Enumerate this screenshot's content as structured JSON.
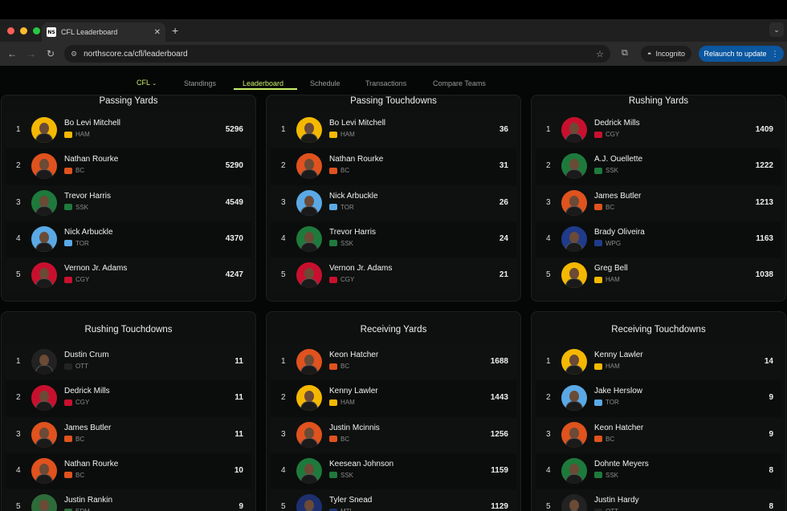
{
  "browser": {
    "tab_title": "CFL Leaderboard",
    "tab_favicon_text": "NS",
    "url": "northscore.ca/cfl/leaderboard",
    "incognito_label": "Incognito",
    "relaunch_label": "Relaunch to update"
  },
  "nav": {
    "league": "CFL",
    "items": [
      "Standings",
      "Leaderboard",
      "Schedule",
      "Transactions",
      "Compare Teams"
    ],
    "active": "Leaderboard"
  },
  "team_colors": {
    "HAM": "#f5b800",
    "BC": "#e0521e",
    "SSK": "#1e7a3c",
    "TOR": "#5aa9e6",
    "CGY": "#c8102e",
    "WPG": "#1f3b8a",
    "OTT": "#222222",
    "EDM": "#2e6b3a",
    "MTL": "#1d2f6f"
  },
  "cards": [
    {
      "title": "Passing Yards",
      "rows": [
        {
          "rank": "1",
          "name": "Bo Levi Mitchell",
          "team": "HAM",
          "value": "5296"
        },
        {
          "rank": "2",
          "name": "Nathan Rourke",
          "team": "BC",
          "value": "5290"
        },
        {
          "rank": "3",
          "name": "Trevor Harris",
          "team": "SSK",
          "value": "4549"
        },
        {
          "rank": "4",
          "name": "Nick Arbuckle",
          "team": "TOR",
          "value": "4370"
        },
        {
          "rank": "5",
          "name": "Vernon Jr. Adams",
          "team": "CGY",
          "value": "4247"
        }
      ]
    },
    {
      "title": "Passing Touchdowns",
      "rows": [
        {
          "rank": "1",
          "name": "Bo Levi Mitchell",
          "team": "HAM",
          "value": "36"
        },
        {
          "rank": "2",
          "name": "Nathan Rourke",
          "team": "BC",
          "value": "31"
        },
        {
          "rank": "3",
          "name": "Nick Arbuckle",
          "team": "TOR",
          "value": "26"
        },
        {
          "rank": "4",
          "name": "Trevor Harris",
          "team": "SSK",
          "value": "24"
        },
        {
          "rank": "5",
          "name": "Vernon Jr. Adams",
          "team": "CGY",
          "value": "21"
        }
      ]
    },
    {
      "title": "Rushing Yards",
      "rows": [
        {
          "rank": "1",
          "name": "Dedrick Mills",
          "team": "CGY",
          "value": "1409"
        },
        {
          "rank": "2",
          "name": "A.J. Ouellette",
          "team": "SSK",
          "value": "1222"
        },
        {
          "rank": "3",
          "name": "James Butler",
          "team": "BC",
          "value": "1213"
        },
        {
          "rank": "4",
          "name": "Brady Oliveira",
          "team": "WPG",
          "value": "1163"
        },
        {
          "rank": "5",
          "name": "Greg Bell",
          "team": "HAM",
          "value": "1038"
        }
      ]
    },
    {
      "title": "Rushing Touchdowns",
      "rows": [
        {
          "rank": "1",
          "name": "Dustin Crum",
          "team": "OTT",
          "value": "11"
        },
        {
          "rank": "2",
          "name": "Dedrick Mills",
          "team": "CGY",
          "value": "11"
        },
        {
          "rank": "3",
          "name": "James Butler",
          "team": "BC",
          "value": "11"
        },
        {
          "rank": "4",
          "name": "Nathan Rourke",
          "team": "BC",
          "value": "10"
        },
        {
          "rank": "5",
          "name": "Justin Rankin",
          "team": "EDM",
          "value": "9"
        }
      ]
    },
    {
      "title": "Receiving Yards",
      "rows": [
        {
          "rank": "1",
          "name": "Keon Hatcher",
          "team": "BC",
          "value": "1688"
        },
        {
          "rank": "2",
          "name": "Kenny Lawler",
          "team": "HAM",
          "value": "1443"
        },
        {
          "rank": "3",
          "name": "Justin Mcinnis",
          "team": "BC",
          "value": "1256"
        },
        {
          "rank": "4",
          "name": "Keesean Johnson",
          "team": "SSK",
          "value": "1159"
        },
        {
          "rank": "5",
          "name": "Tyler Snead",
          "team": "MTL",
          "value": "1129"
        }
      ]
    },
    {
      "title": "Receiving Touchdowns",
      "rows": [
        {
          "rank": "1",
          "name": "Kenny Lawler",
          "team": "HAM",
          "value": "14"
        },
        {
          "rank": "2",
          "name": "Jake Herslow",
          "team": "TOR",
          "value": "9"
        },
        {
          "rank": "3",
          "name": "Keon Hatcher",
          "team": "BC",
          "value": "9"
        },
        {
          "rank": "4",
          "name": "Dohnte Meyers",
          "team": "SSK",
          "value": "8"
        },
        {
          "rank": "5",
          "name": "Justin Hardy",
          "team": "OTT",
          "value": "8"
        }
      ]
    }
  ]
}
